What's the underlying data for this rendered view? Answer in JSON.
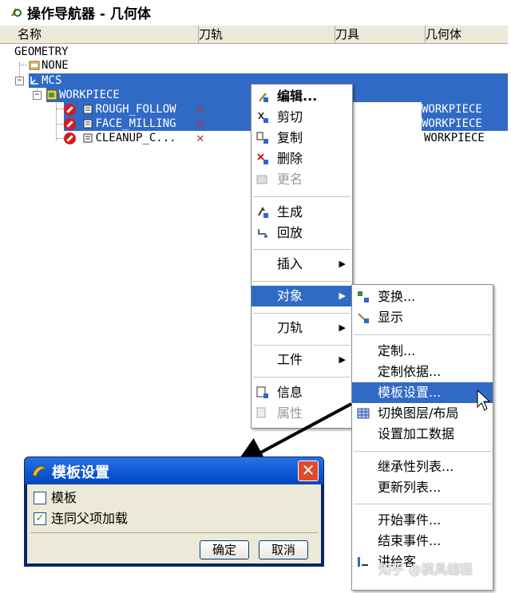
{
  "navigator": {
    "title": "操作导航器 - 几何体",
    "columns": [
      "名称",
      "刀轨",
      "刀具",
      "几何体"
    ],
    "tree": {
      "root": "GEOMETRY",
      "none": "NONE",
      "mcs": "MCS",
      "workpiece": "WORKPIECE",
      "operations": [
        {
          "name": "ROUGH_FOLLOW",
          "geometry": "WORKPIECE"
        },
        {
          "name": "FACE_MILLING",
          "geometry": "WORKPIECE"
        },
        {
          "name": "CLEANUP_C...",
          "geometry": "WORKPIECE"
        }
      ]
    }
  },
  "context_menu": {
    "edit": "编辑...",
    "cut": "剪切",
    "copy": "复制",
    "delete": "删除",
    "rename": "更名",
    "generate": "生成",
    "replay": "回放",
    "insert": "插入",
    "object": "对象",
    "toolpath": "刀轨",
    "workpiece": "工件",
    "info": "信息",
    "properties": "属性"
  },
  "submenu": {
    "transform": "变换...",
    "display": "显示",
    "customize": "定制...",
    "customize_basis": "定制依据...",
    "template_setup": "模板设置...",
    "toggle_layer": "切换图层/布局",
    "set_machining_data": "设置加工数据",
    "inheritance_list": "继承性列表...",
    "update_list": "更新列表...",
    "start_event": "开始事件...",
    "end_event": "结束事件...",
    "post_process": "讲给客"
  },
  "dialog": {
    "title": "模板设置",
    "template_label": "模板",
    "template_checked": false,
    "load_with_parent_label": "连同父项加载",
    "load_with_parent_checked": true,
    "ok": "确定",
    "cancel": "取消"
  },
  "watermark": "知乎 @模具编程",
  "colors": {
    "selection": "#316ac5",
    "dialog_title": "#0a58d2",
    "close_button": "#e04b2a"
  }
}
